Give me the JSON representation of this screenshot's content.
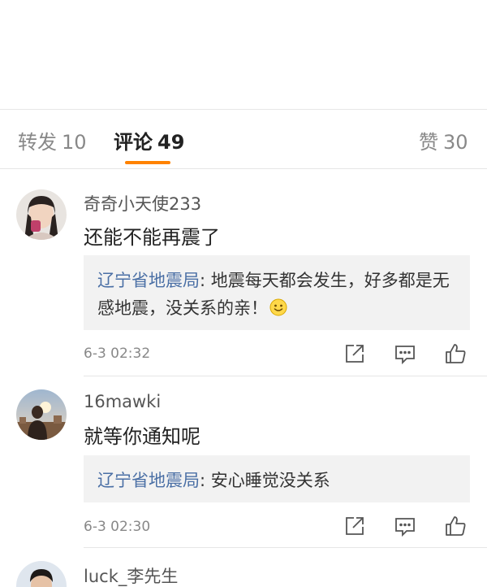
{
  "tabs": [
    {
      "label": "转发",
      "count": "10"
    },
    {
      "label": "评论",
      "count": "49"
    },
    {
      "label": "赞",
      "count": "30"
    }
  ],
  "comments": [
    {
      "username": "奇奇小天使233",
      "text": "还能不能再震了",
      "reply": {
        "author": "辽宁省地震局",
        "sep": ": ",
        "text": "地震每天都会发生，好多都是无感地震，没关系的亲！"
      },
      "time": "6-3 02:32"
    },
    {
      "username": "16mawki",
      "text": "就等你通知呢",
      "reply": {
        "author": "辽宁省地震局",
        "sep": ": ",
        "text": "安心睡觉没关系"
      },
      "time": "6-3 02:30"
    },
    {
      "username": "luck_李先生"
    }
  ],
  "icons": {
    "share": "share-icon",
    "comment": "comment-icon",
    "like": "like-icon",
    "emoji": "smile-emoji-icon"
  },
  "colors": {
    "accent": "#ff8200",
    "link": "#4a6fa5",
    "reply_bg": "#f2f2f2"
  }
}
